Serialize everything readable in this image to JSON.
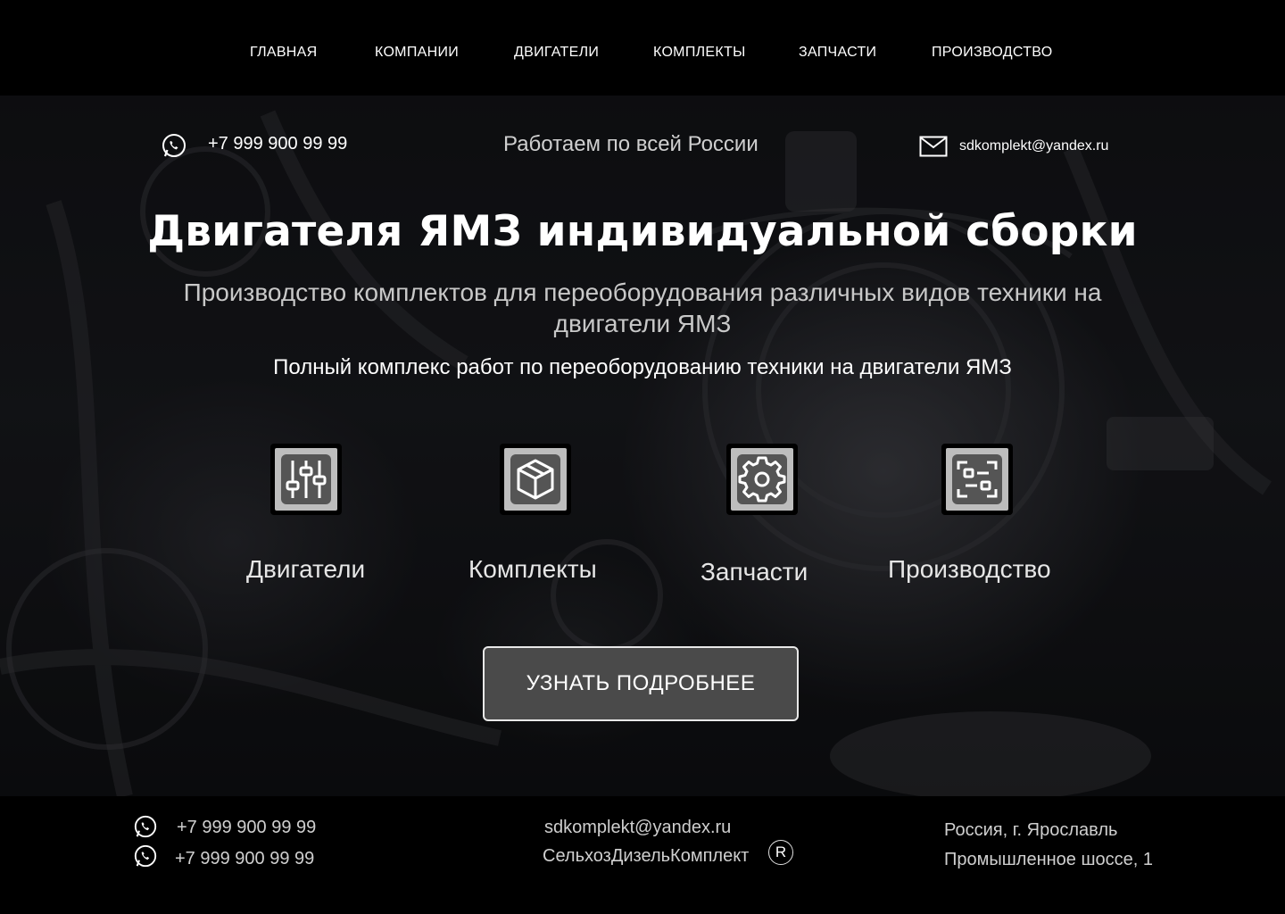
{
  "nav": {
    "items": [
      "ГЛАВНАЯ",
      "КОМПАНИИ",
      "ДВИГАТЕЛИ",
      "КОМПЛЕКТЫ",
      "ЗАПЧАСТИ",
      "ПРОИЗВОДСТВО"
    ]
  },
  "hero": {
    "phone": "+7 999 900 99 99",
    "region": "Работаем по всей России",
    "email": "sdkomplekt@yandex.ru",
    "title": "Двигателя ЯМЗ индивидуальной сборки",
    "subtitle": "Производство комплектов для переоборудования различных видов техники на двигатели ЯМЗ",
    "tagline": "Полный комплекс работ по переоборудованию техники на двигатели ЯМЗ",
    "features": [
      {
        "label": "Двигатели",
        "icon": "sliders-icon"
      },
      {
        "label": "Комплекты",
        "icon": "box-icon"
      },
      {
        "label": "Запчасти",
        "icon": "gear-icon"
      },
      {
        "label": "Производство",
        "icon": "scan-icon"
      }
    ],
    "cta_label": "УЗНАТЬ ПОДРОБНЕЕ"
  },
  "footer": {
    "phones": [
      "+7 999 900 99 99",
      "+7 999 900 99 99"
    ],
    "email": "sdkomplekt@yandex.ru",
    "company": "СельхозДизельКомплект",
    "registered_mark": "R",
    "address_line1": "Россия, г. Ярославль",
    "address_line2": "Промышленное шоссе, 1"
  },
  "colors": {
    "background": "#000000",
    "icon_tile": "#bdbdbd",
    "icon_glyph": "#555555",
    "button_fill": "#4a4a4a"
  }
}
